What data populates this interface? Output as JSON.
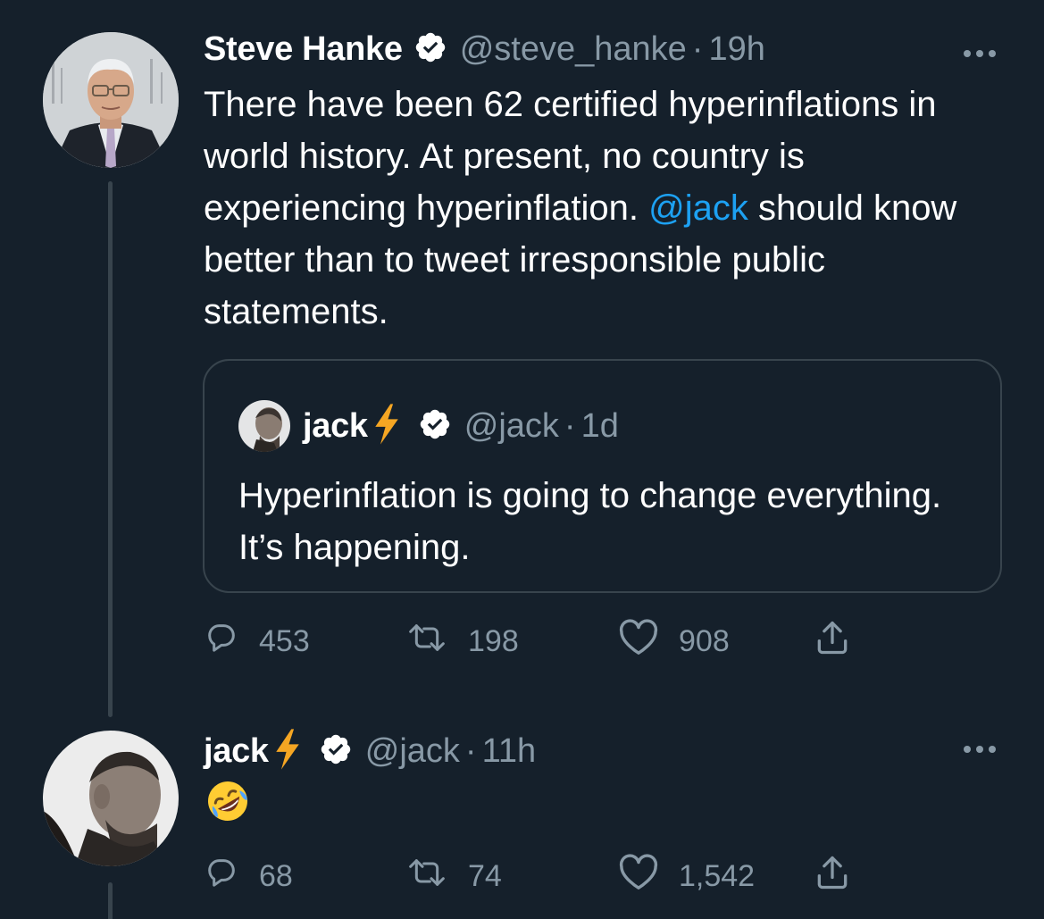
{
  "tweet": {
    "author_name": "Steve Hanke",
    "handle": "@steve_hanke",
    "separator": "·",
    "time": "19h",
    "text_before": "There have been 62 certified hyperinflations in world history. At present, no country is experiencing hyperinflation. ",
    "mention": "@jack",
    "text_after": " should know better than to tweet irresponsible public statements.",
    "quote": {
      "author_name": "jack",
      "handle": "@jack",
      "separator": "·",
      "time": "1d",
      "text": "Hyperinflation is going to change everything. It’s happening."
    },
    "actions": {
      "replies": "453",
      "retweets": "198",
      "likes": "908"
    }
  },
  "reply": {
    "author_name": "jack",
    "handle": "@jack",
    "separator": "·",
    "time": "11h",
    "emoji": "rolling-on-the-floor-laughing",
    "actions": {
      "replies": "68",
      "retweets": "74",
      "likes": "1,542"
    }
  },
  "colors": {
    "background": "#15202b",
    "border": "#38444d",
    "secondary_text": "#8899a6",
    "link": "#1da1f2",
    "verified": "#ffffff",
    "bolt": "#f5a623"
  },
  "icons": [
    "more-icon",
    "verified-badge-icon",
    "lightning-bolt-icon",
    "reply-icon",
    "retweet-icon",
    "like-icon",
    "share-icon"
  ]
}
